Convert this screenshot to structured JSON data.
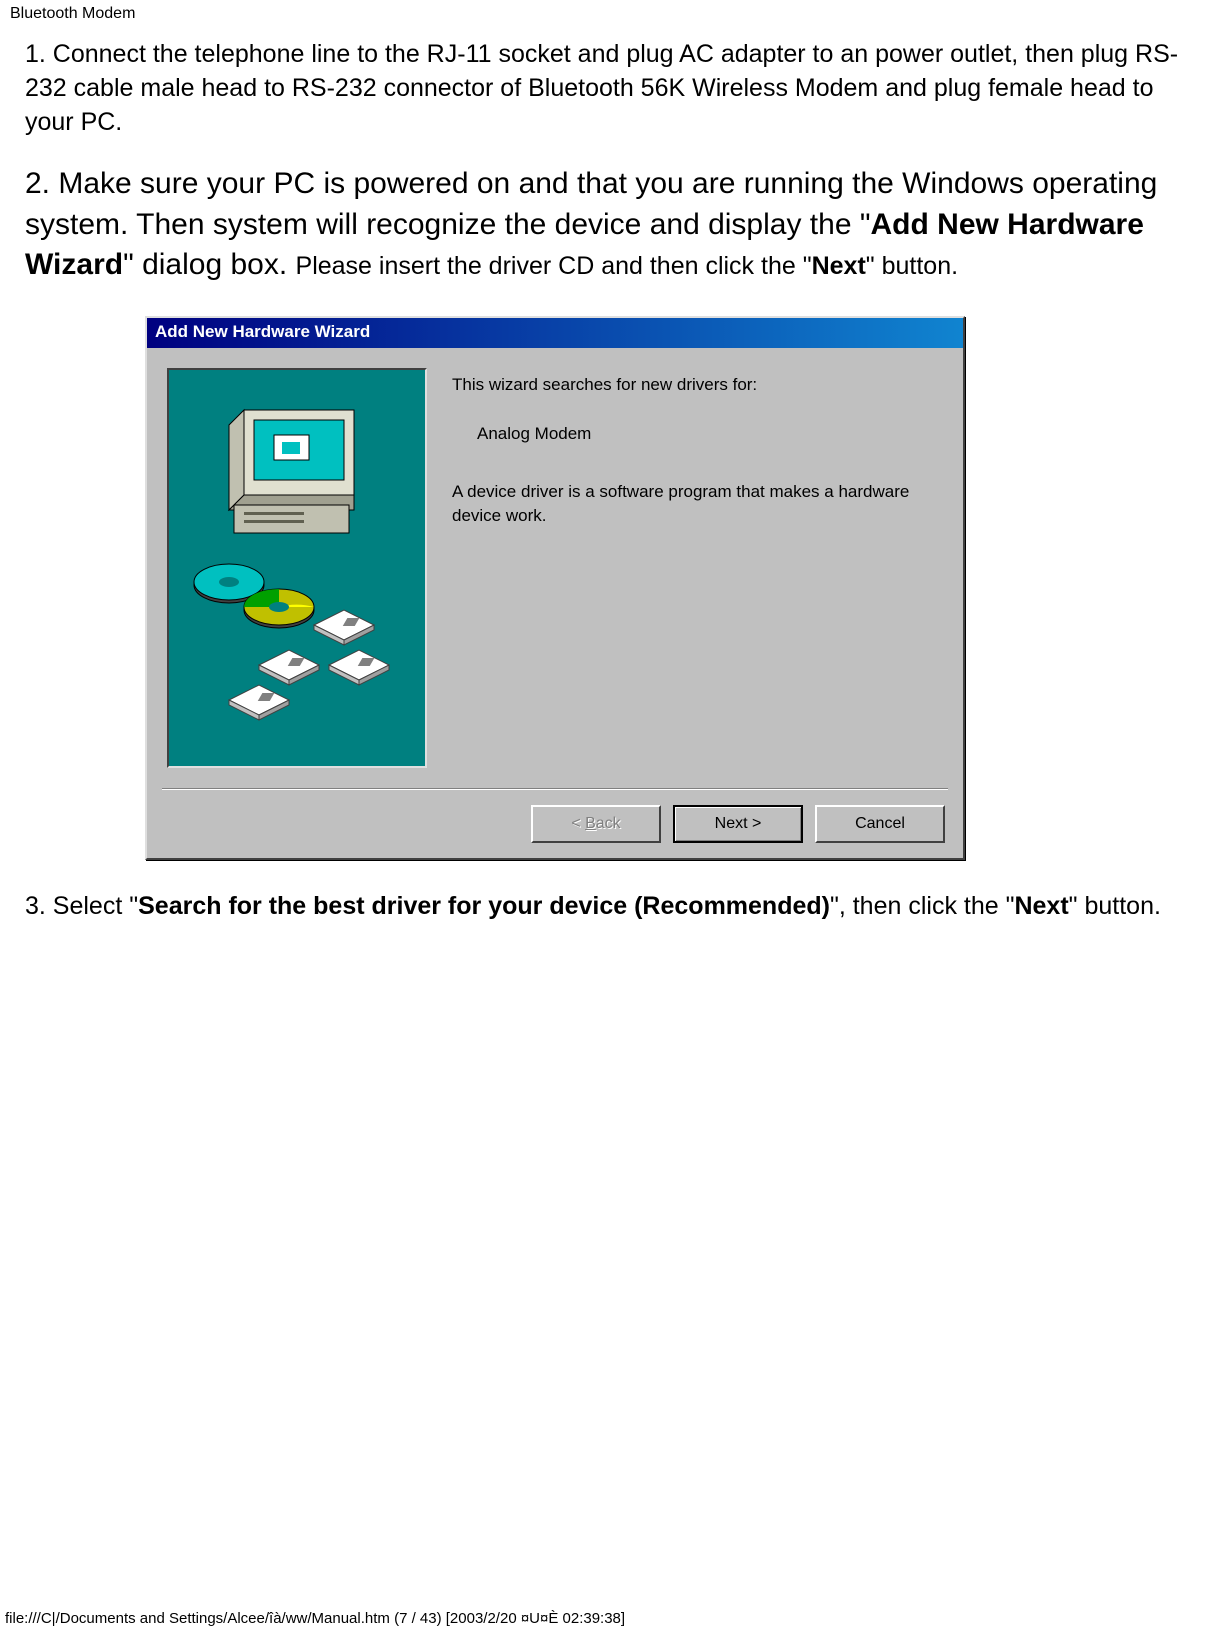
{
  "header": {
    "title": "Bluetooth Modem"
  },
  "step1": {
    "text": "1. Connect the telephone line to the RJ-11 socket and plug AC adapter to an power outlet, then plug RS-232 cable male head to RS-232 connector of Bluetooth 56K Wireless Modem and plug female head to your PC."
  },
  "step2": {
    "text_lead": "2. Make sure your PC is powered on and that you are running the Windows operating system. Then system will recognize the device and display the \"",
    "bold_wizard": "Add New Hardware Wizard",
    "text_mid": "\" dialog box. ",
    "trailing_1": "Please insert the driver CD and then click the \"",
    "trailing_bold": "Next",
    "trailing_2": "\" button."
  },
  "wizard": {
    "title": "Add New Hardware Wizard",
    "search_text": "This wizard searches for new drivers for:",
    "device_name": "Analog Modem",
    "device_desc": "A device driver is a software program that makes a hardware device work.",
    "buttons": {
      "back_prefix": "< ",
      "back_underline": "B",
      "back_rest": "ack",
      "next": "Next >",
      "cancel": "Cancel"
    }
  },
  "step3": {
    "text_1": "3. Select \"",
    "bold_search": "Search for the best driver for your device (Recommended)",
    "text_2": "\", then click the \"",
    "bold_next": "Next",
    "text_3": "\" button."
  },
  "footer": {
    "path": "file:///C|/Documents and Settings/Alcee/îà/ww/Manual.htm (7 / 43) [2003/2/20 ¤U¤È 02:39:38]"
  }
}
